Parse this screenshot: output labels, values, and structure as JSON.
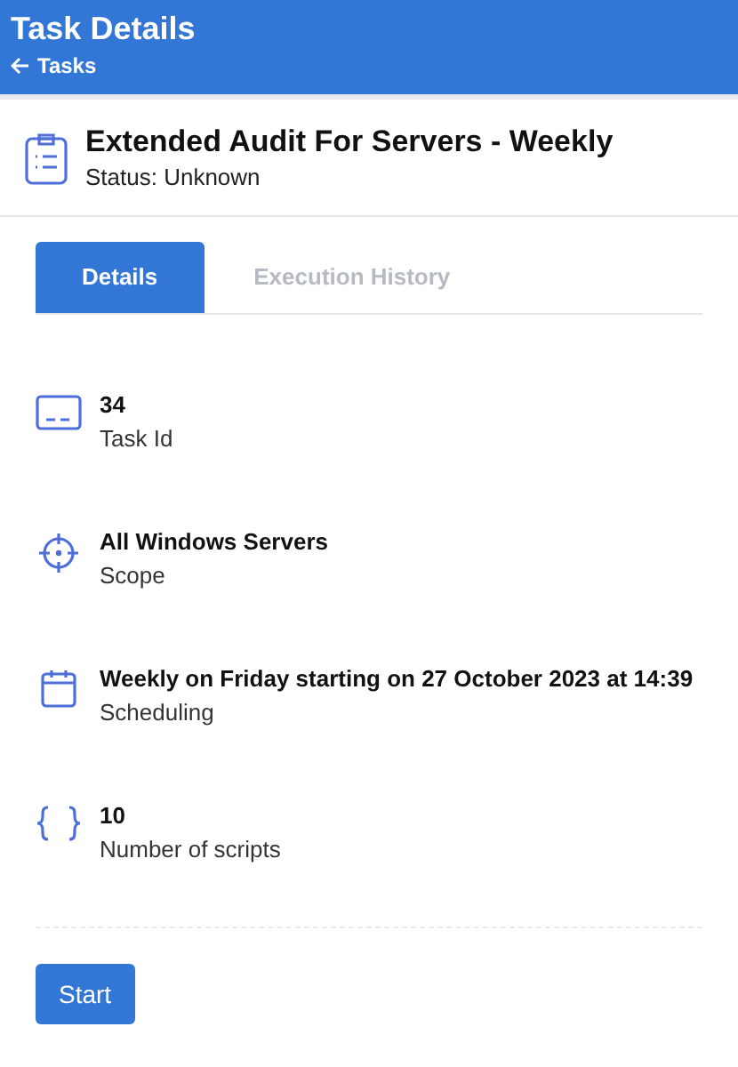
{
  "header": {
    "title": "Task Details",
    "back_link": "Tasks"
  },
  "task": {
    "name": "Extended Audit For Servers - Weekly",
    "status": "Status: Unknown"
  },
  "tabs": [
    {
      "label": "Details",
      "selected": true
    },
    {
      "label": "Execution History",
      "selected": false
    }
  ],
  "details": [
    {
      "kind": "id",
      "value": "34",
      "label": "Task Id"
    },
    {
      "kind": "scope",
      "value": "All Windows Servers",
      "label": "Scope"
    },
    {
      "kind": "schedule",
      "value": "Weekly on Friday starting on 27 October 2023 at 14:39",
      "label": "Scheduling"
    },
    {
      "kind": "scripts",
      "value": "10",
      "label": "Number of scripts"
    }
  ],
  "start_button": "Start"
}
